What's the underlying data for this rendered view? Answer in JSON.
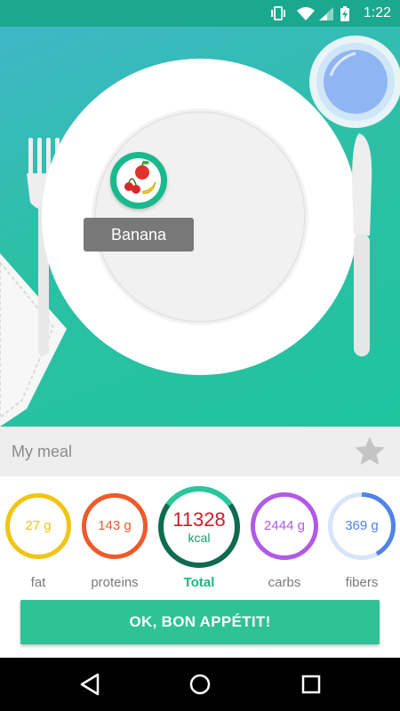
{
  "status_bar": {
    "time": "1:22",
    "icons": [
      "vibrate-icon",
      "wifi-icon",
      "signal-icon",
      "battery-charging-icon"
    ]
  },
  "scene": {
    "food_icon": "fruit-icon",
    "selected_food": "Banana"
  },
  "meal": {
    "name": "My meal",
    "favorite_icon": "star-icon"
  },
  "nutrients": {
    "fat": {
      "value": "27 g",
      "label": "fat",
      "color": "#f2c414",
      "fraction": 1.0
    },
    "proteins": {
      "value": "143 g",
      "label": "proteins",
      "color": "#ef5a2a",
      "fraction": 1.0
    },
    "total": {
      "value": "11328",
      "unit": "kcal",
      "label": "Total",
      "color": "#0f6b4f"
    },
    "carbs": {
      "value": "2444 g",
      "label": "carbs",
      "color": "#b15ae6",
      "fraction": 1.0
    },
    "fibers": {
      "value": "369 g",
      "label": "fibers",
      "color": "#4f84e8",
      "fraction": 0.42
    }
  },
  "action": {
    "ok_label": "OK, BON APPÉTIT!"
  },
  "nav_bar": {
    "icons": [
      "back-icon",
      "home-icon",
      "recents-icon"
    ]
  }
}
